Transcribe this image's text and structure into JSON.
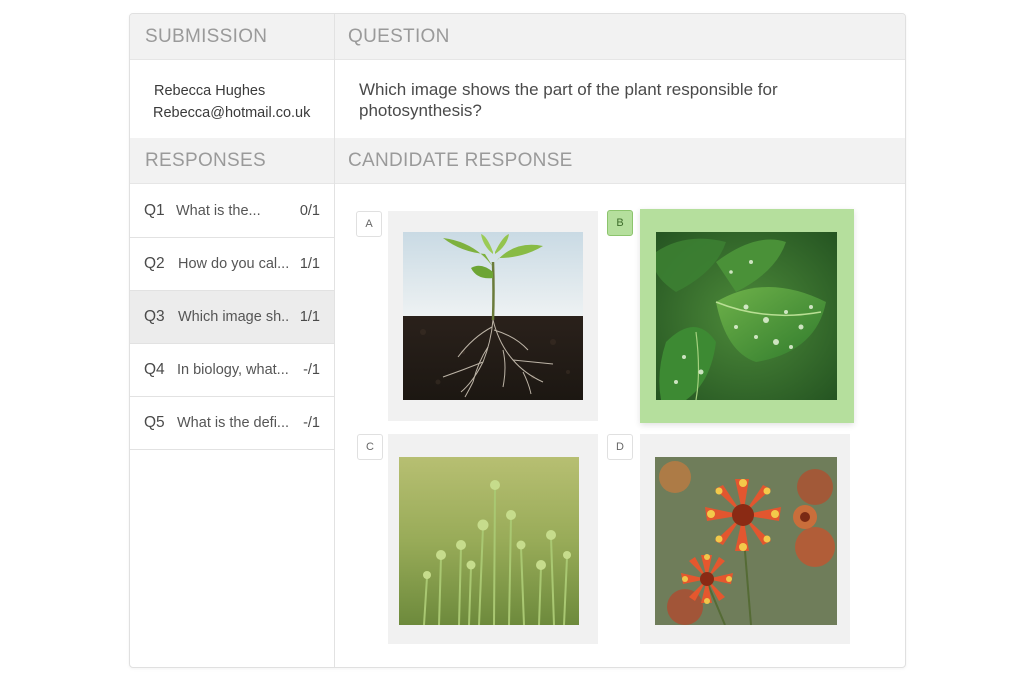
{
  "headers": {
    "submission": "SUBMISSION",
    "question": "QUESTION",
    "responses": "RESPONSES",
    "candidate_response": "CANDIDATE RESPONSE"
  },
  "submitter": {
    "name": "Rebecca Hughes",
    "email": "Rebecca@hotmail.co.uk"
  },
  "question_text": "Which image shows the part of the plant responsible for photosynthesis?",
  "responses": [
    {
      "num": "Q1",
      "text": "What is the...",
      "score": "0/1"
    },
    {
      "num": "Q2",
      "text": "How do you cal...",
      "score": "1/1"
    },
    {
      "num": "Q3",
      "text": "Which image sh..",
      "score": "1/1"
    },
    {
      "num": "Q4",
      "text": "In biology, what...",
      "score": "-/1"
    },
    {
      "num": "Q5",
      "text": "What is the defi...",
      "score": "-/1"
    }
  ],
  "active_response": "Q3",
  "options": [
    {
      "letter": "A",
      "image": "seedling-with-roots",
      "selected": false
    },
    {
      "letter": "B",
      "image": "green-leaves-with-water-drops",
      "selected": true
    },
    {
      "letter": "C",
      "image": "green-flower-buds",
      "selected": false
    },
    {
      "letter": "D",
      "image": "red-yellow-flowers",
      "selected": false
    }
  ],
  "colors": {
    "selected_green": "#b5df9d",
    "header_bg": "#f2f2f2",
    "header_text": "#9a9a9a",
    "active_row": "#ececec"
  }
}
